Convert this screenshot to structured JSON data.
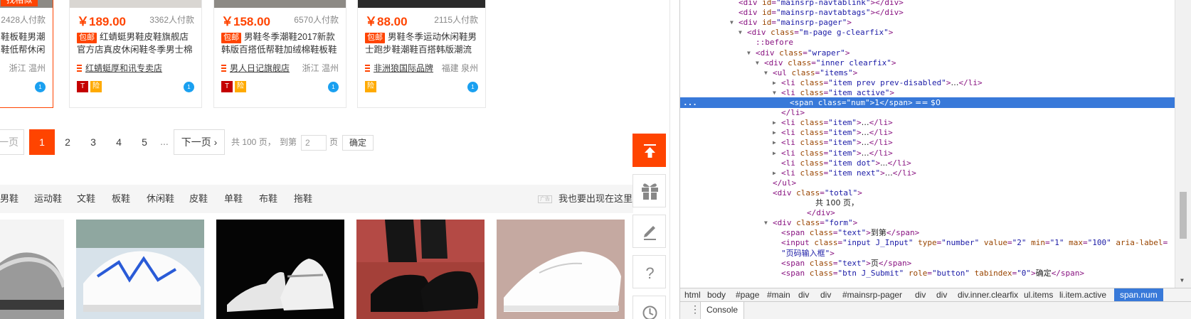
{
  "products": [
    {
      "tag": "找相似",
      "sales": "2428人付款",
      "title1": "鞋板鞋男潮",
      "title2": "鞋低帮休闲",
      "loc": "浙江 温州",
      "ww": "1"
    },
    {
      "price": "￥189.00",
      "sales": "3362人付款",
      "badge": "包邮",
      "title1": "红蜻蜓男鞋皮鞋旗舰店",
      "title2": "官方店真皮休闲鞋冬季男士棉",
      "shop": "红蜻蜓厚和讯专卖店",
      "tm": "T",
      "xb": "险",
      "ww": "1"
    },
    {
      "price": "￥158.00",
      "sales": "6570人付款",
      "badge": "包邮",
      "title1": "男鞋冬季潮鞋2017新款",
      "title2": "韩版百搭低帮鞋加绒棉鞋板鞋",
      "shop": "男人日记旗舰店",
      "loc": "浙江 温州",
      "tm": "T",
      "xb": "险",
      "ww": "1"
    },
    {
      "price": "￥88.00",
      "sales": "2115人付款",
      "badge": "包邮",
      "title1": "男鞋冬季运动休闲鞋男",
      "title2": "士跑步鞋潮鞋百搭韩版潮流",
      "shop": "非洲狼国际品牌",
      "loc": "福建 泉州",
      "xb": "险",
      "ww": "1"
    }
  ],
  "pager": {
    "prev": "一页",
    "pages": [
      "1",
      "2",
      "3",
      "4",
      "5"
    ],
    "dot": "...",
    "next": "下一页",
    "total": "共 100 页，",
    "goto": "到第",
    "jump_value": "2",
    "ye": "页",
    "ok": "确定"
  },
  "categories": [
    "男鞋",
    "运动鞋",
    "文鞋",
    "板鞋",
    "休闲鞋",
    "皮鞋",
    "单鞋",
    "布鞋",
    "拖鞋"
  ],
  "ad": {
    "tag": "广告",
    "text": "我也要出现在这里"
  },
  "devtools": {
    "lines": [
      {
        "indent": 82,
        "tri": "",
        "html": "<span class='tag'>&lt;div</span> <span class='an'>id</span>=<span class='av'>\"mainsrp-navtablink\"</span><span class='tag'>&gt;&lt;/div&gt;</span>"
      },
      {
        "indent": 82,
        "tri": "",
        "html": "<span class='tag'>&lt;div</span> <span class='an'>id</span>=<span class='av'>\"mainsrp-navtabtags\"</span><span class='tag'>&gt;&lt;/div&gt;</span>"
      },
      {
        "indent": 82,
        "tri": "▼",
        "html": "<span class='tag'>&lt;div</span> <span class='an'>id</span>=<span class='av'>\"mainsrp-pager\"</span><span class='tag'>&gt;</span>"
      },
      {
        "indent": 94,
        "tri": "▼",
        "html": "<span class='tag'>&lt;div</span> <span class='an'>class</span>=<span class='av'>\"m-page g-clearfix\"</span><span class='tag'>&gt;</span>"
      },
      {
        "indent": 106,
        "tri": "",
        "html": "<span class='pseudo'>::before</span>"
      },
      {
        "indent": 106,
        "tri": "▼",
        "html": "<span class='tag'>&lt;div</span> <span class='an'>class</span>=<span class='av'>\"wraper\"</span><span class='tag'>&gt;</span>"
      },
      {
        "indent": 118,
        "tri": "▼",
        "html": "<span class='tag'>&lt;div</span> <span class='an'>class</span>=<span class='av'>\"inner clearfix\"</span><span class='tag'>&gt;</span>"
      },
      {
        "indent": 130,
        "tri": "▼",
        "html": "<span class='tag'>&lt;ul</span> <span class='an'>class</span>=<span class='av'>\"items\"</span><span class='tag'>&gt;</span>"
      },
      {
        "indent": 142,
        "tri": "▶",
        "html": "<span class='tag'>&lt;li</span> <span class='an'>class</span>=<span class='av'>\"item prev prev-disabled\"</span><span class='tag'>&gt;</span><span class='txt'>…</span><span class='tag'>&lt;/li&gt;</span>"
      },
      {
        "indent": 142,
        "tri": "▼",
        "html": "<span class='tag'>&lt;li</span> <span class='an'>class</span>=<span class='av'>\"item active\"</span><span class='tag'>&gt;</span>"
      },
      {
        "indent": 154,
        "tri": "",
        "sel": true,
        "html": "<span class='tag'>&lt;span</span> <span class='an'>class</span>=<span class='av'>\"num\"</span><span class='tag'>&gt;</span><span class='txt'>1</span><span class='tag'>&lt;/span&gt;</span><span class='txt'> == $0</span>"
      },
      {
        "indent": 142,
        "tri": "",
        "html": "<span class='tag'>&lt;/li&gt;</span>"
      },
      {
        "indent": 142,
        "tri": "▶",
        "html": "<span class='tag'>&lt;li</span> <span class='an'>class</span>=<span class='av'>\"item\"</span><span class='tag'>&gt;</span><span class='txt'>…</span><span class='tag'>&lt;/li&gt;</span>"
      },
      {
        "indent": 142,
        "tri": "▶",
        "html": "<span class='tag'>&lt;li</span> <span class='an'>class</span>=<span class='av'>\"item\"</span><span class='tag'>&gt;</span><span class='txt'>…</span><span class='tag'>&lt;/li&gt;</span>"
      },
      {
        "indent": 142,
        "tri": "▶",
        "html": "<span class='tag'>&lt;li</span> <span class='an'>class</span>=<span class='av'>\"item\"</span><span class='tag'>&gt;</span><span class='txt'>…</span><span class='tag'>&lt;/li&gt;</span>"
      },
      {
        "indent": 142,
        "tri": "▶",
        "html": "<span class='tag'>&lt;li</span> <span class='an'>class</span>=<span class='av'>\"item\"</span><span class='tag'>&gt;</span><span class='txt'>…</span><span class='tag'>&lt;/li&gt;</span>"
      },
      {
        "indent": 142,
        "tri": "",
        "html": "<span class='tag'>&lt;li</span> <span class='an'>class</span>=<span class='av'>\"item dot\"</span><span class='tag'>&gt;</span><span class='txt'>...</span><span class='tag'>&lt;/li&gt;</span>"
      },
      {
        "indent": 142,
        "tri": "▶",
        "html": "<span class='tag'>&lt;li</span> <span class='an'>class</span>=<span class='av'>\"item next\"</span><span class='tag'>&gt;</span><span class='txt'>…</span><span class='tag'>&lt;/li&gt;</span>"
      },
      {
        "indent": 130,
        "tri": "",
        "html": "<span class='tag'>&lt;/ul&gt;</span>"
      },
      {
        "indent": 130,
        "tri": "",
        "html": "<span class='tag'>&lt;div</span> <span class='an'>class</span>=<span class='av'>\"total\"</span><span class='tag'>&gt;</span>"
      },
      {
        "indent": 190,
        "tri": "",
        "html": "<span class='txt'>共 100 页，</span>"
      },
      {
        "indent": 178,
        "tri": "",
        "html": "<span class='tag'>&lt;/div&gt;</span>"
      },
      {
        "indent": 130,
        "tri": "▼",
        "html": "<span class='tag'>&lt;div</span> <span class='an'>class</span>=<span class='av'>\"form\"</span><span class='tag'>&gt;</span>"
      },
      {
        "indent": 142,
        "tri": "",
        "html": "<span class='tag'>&lt;span</span> <span class='an'>class</span>=<span class='av'>\"text\"</span><span class='tag'>&gt;</span><span class='txt'>到第</span><span class='tag'>&lt;/span&gt;</span>"
      },
      {
        "indent": 142,
        "tri": "",
        "html": "<span class='tag'>&lt;input</span> <span class='an'>class</span>=<span class='av'>\"input J_Input\"</span> <span class='an'>type</span>=<span class='av'>\"number\"</span> <span class='an'>value</span>=<span class='av'>\"2\"</span> <span class='an'>min</span>=<span class='av'>\"1\"</span> <span class='an'>max</span>=<span class='av'>\"100\"</span> <span class='an'>aria-label</span>="
      },
      {
        "indent": 142,
        "tri": "",
        "html": "<span class='av'>\"页码输入框\"</span><span class='tag'>&gt;</span>"
      },
      {
        "indent": 142,
        "tri": "",
        "html": "<span class='tag'>&lt;span</span> <span class='an'>class</span>=<span class='av'>\"text\"</span><span class='tag'>&gt;</span><span class='txt'>页</span><span class='tag'>&lt;/span&gt;</span>"
      },
      {
        "indent": 142,
        "tri": "",
        "html": "<span class='tag'>&lt;span</span> <span class='an'>class</span>=<span class='av'>\"btn J_Submit\"</span> <span class='an'>role</span>=<span class='av'>\"button\"</span> <span class='an'>tabindex</span>=<span class='av'>\"0\"</span><span class='tag'>&gt;</span><span class='txt'>确定</span><span class='tag'>&lt;/span&gt;</span>"
      }
    ],
    "crumbs": [
      "html",
      "body",
      "#page",
      "#main",
      "div",
      "div",
      "#mainsrp-pager",
      "div",
      "div",
      "div.inner.clearfix",
      "ul.items",
      "li.item.active",
      "span.num"
    ],
    "console_tab": "Console"
  },
  "colors": {
    "accent": "#ff4400",
    "selection": "#3879d9"
  }
}
